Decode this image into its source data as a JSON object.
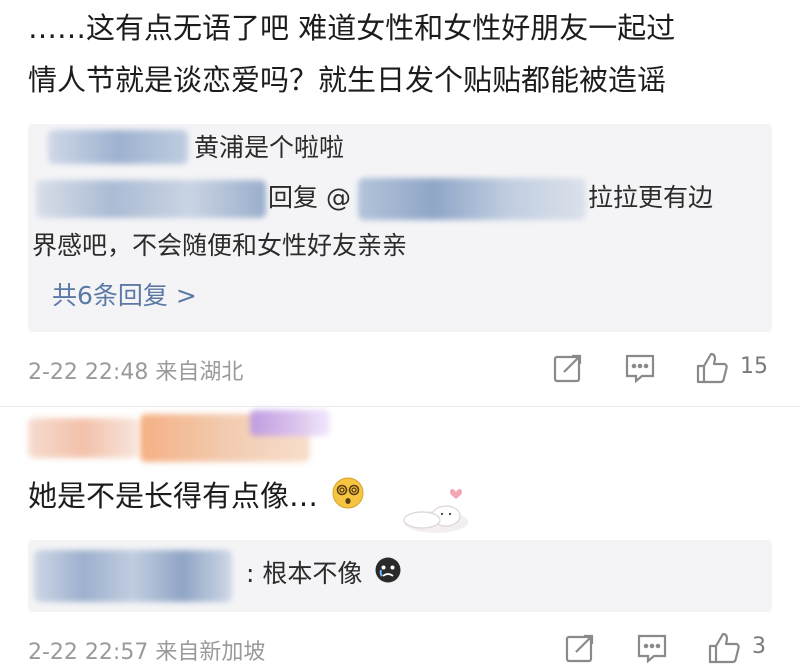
{
  "post": {
    "line1": "……这有点无语了吧 难道女性和女性好朋友一起过",
    "line2": "情人节就是谈恋爱吗？就生日发个贴贴都能被造谣"
  },
  "reply_box_1": {
    "author_name": "黄浦是个啦啦",
    "reply_prefix": "回复 @",
    "reply_text_tail": "拉拉更有边",
    "reply_line3": "界感吧，不会随便和女性好友亲亲",
    "more_replies_link": "共6条回复 >"
  },
  "meta_1": {
    "time_location": "2-22 22:48 来自湖北",
    "like_count": "15"
  },
  "comment_2": {
    "text": "她是不是长得有点像…"
  },
  "reply_box_2": {
    "reply_text": "根本不像"
  },
  "meta_2": {
    "time_location": "2-22 22:57 来自新加坡",
    "like_count": "3"
  },
  "icons": {
    "share": "share-icon",
    "comment": "comment-icon",
    "like": "thumbs-up-icon",
    "dizzy_face": "dizzy-face-emoji",
    "crying_face": "crying-face-emoji",
    "sticker": "rabbit-sticker"
  },
  "colors": {
    "link": "#5b79a6",
    "meta_text": "#9a9a9a",
    "reply_bg": "#f4f4f6"
  }
}
